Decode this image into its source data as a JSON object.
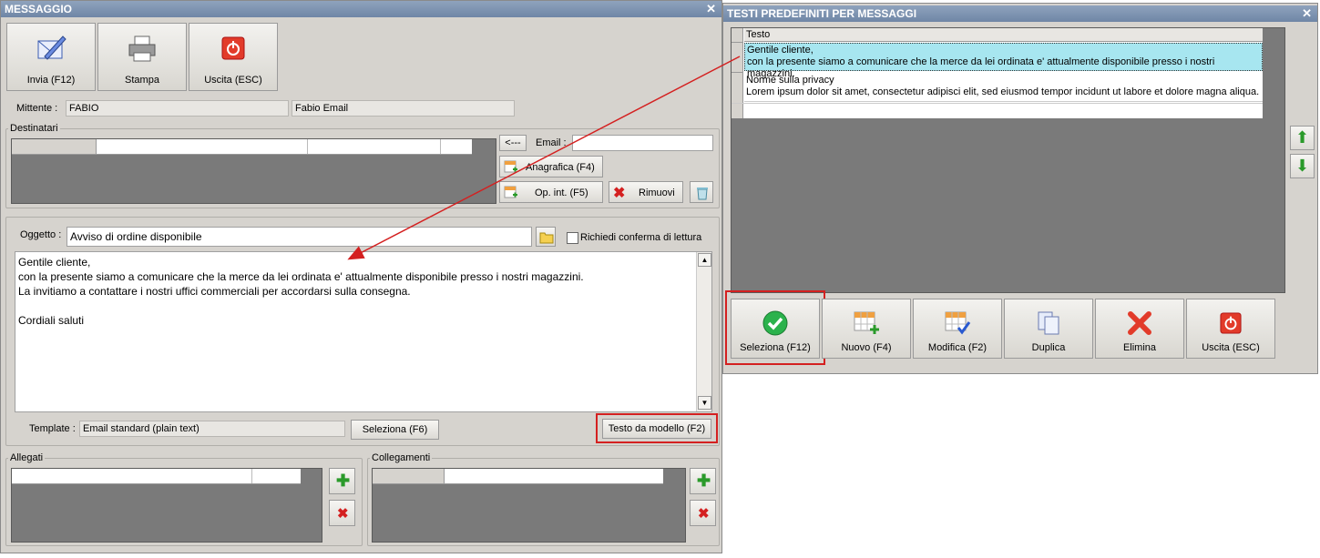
{
  "main": {
    "title": "MESSAGGIO",
    "toolbar": {
      "invia": "Invia (F12)",
      "stampa": "Stampa",
      "uscita": "Uscita (ESC)"
    },
    "mittente_label": "Mittente :",
    "mittente_code": "FABIO",
    "mittente_name": "Fabio Email",
    "destinatari": {
      "title": "Destinatari",
      "arrow_btn": "<---",
      "email_label": "Email :",
      "anagrafica_btn": "Anagrafica (F4)",
      "opint_btn": "Op. int. (F5)",
      "rimuovi_btn": "Rimuovi"
    },
    "oggetto_label": "Oggetto :",
    "oggetto_value": "Avviso di ordine disponibile",
    "richiedi_label": "Richiedi conferma di lettura",
    "body_lines": [
      "Gentile cliente,",
      "con la presente siamo a comunicare che la merce da lei ordinata e' attualmente disponibile presso i nostri magazzini.",
      "La invitiamo a contattare i nostri uffici commerciali per accordarsi sulla consegna.",
      "",
      "Cordiali saluti"
    ],
    "template_label": "Template :",
    "template_value": "Email standard (plain text)",
    "seleziona_btn": "Seleziona (F6)",
    "testo_btn": "Testo da modello (F2)",
    "allegati_title": "Allegati",
    "collegamenti_title": "Collegamenti"
  },
  "dialog": {
    "title": "TESTI PREDEFINITI PER MESSAGGI",
    "column_header": "Testo",
    "rows": [
      {
        "line1": "Gentile cliente,",
        "line2": "con la presente siamo a comunicare che la merce da lei ordinata e' attualmente disponibile presso i nostri magazzini."
      },
      {
        "line1": "Norme sulla privacy",
        "line2": "Lorem ipsum dolor sit amet, consectetur adipisci elit, sed eiusmod tempor incidunt ut labore et dolore magna aliqua."
      }
    ],
    "buttons": {
      "seleziona": "Seleziona (F12)",
      "nuovo": "Nuovo (F4)",
      "modifica": "Modifica (F2)",
      "duplica": "Duplica",
      "elimina": "Elimina",
      "uscita": "Uscita (ESC)"
    }
  },
  "colors": {
    "highlight": "#d42020",
    "selected_row": "#a7e6f0",
    "title_bar": "#7a8fae"
  }
}
